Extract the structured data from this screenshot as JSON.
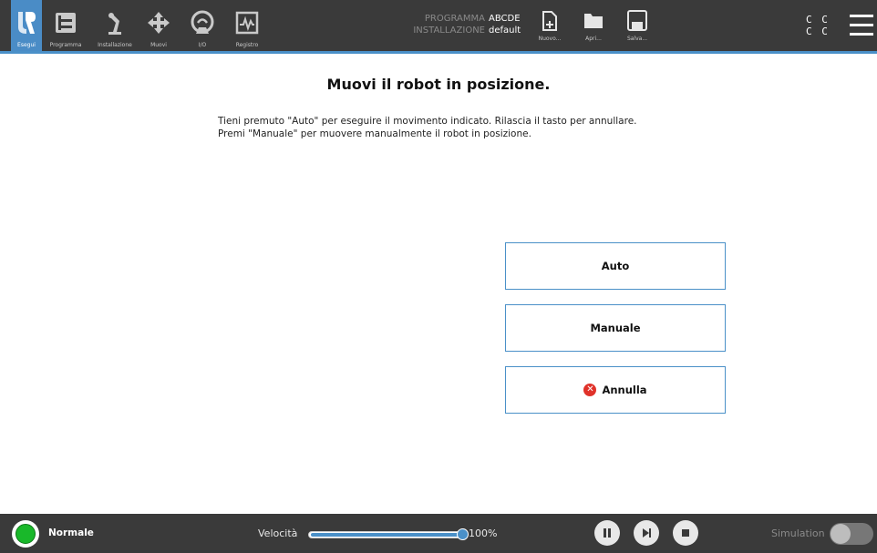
{
  "topbar": {
    "nav": [
      {
        "name": "Esegui",
        "icon": "ur-logo-icon",
        "active": true
      },
      {
        "name": "Programma",
        "icon": "program-tree-icon",
        "active": false
      },
      {
        "name": "Installazione",
        "icon": "installation-arm-icon",
        "active": false
      },
      {
        "name": "Muovi",
        "icon": "move-arrows-icon",
        "active": false
      },
      {
        "name": "I/O",
        "icon": "io-icon",
        "active": false
      },
      {
        "name": "Registro",
        "icon": "log-chart-icon",
        "active": false
      }
    ],
    "program_label": "PROGRAMMA",
    "program_value": "ABCDE",
    "installation_label": "INSTALLAZIONE",
    "installation_value": "default",
    "file_actions": {
      "new": "Nuovo...",
      "open": "Apri...",
      "save": "Salva..."
    },
    "cc_row1": "C C",
    "cc_row2": "C C",
    "accent_color": "#4a90c8"
  },
  "main": {
    "title": "Muovi il robot in posizione.",
    "instruction_line1": "Tieni premuto \"Auto\" per eseguire il movimento indicato. Rilascia il tasto per annullare.",
    "instruction_line2": "Premi \"Manuale\" per muovere manualmente il robot in posizione.",
    "auto_label": "Auto",
    "manual_label": "Manuale",
    "cancel_label": "Annulla",
    "cancel_icon": "cancel-x-icon"
  },
  "bottombar": {
    "mode": "Normale",
    "speed_label": "Velocità",
    "speed_value": "100%",
    "speed_fraction": 1.0,
    "simulation_label": "Simulation",
    "simulation_on": false,
    "status_color": "#19b82a"
  }
}
